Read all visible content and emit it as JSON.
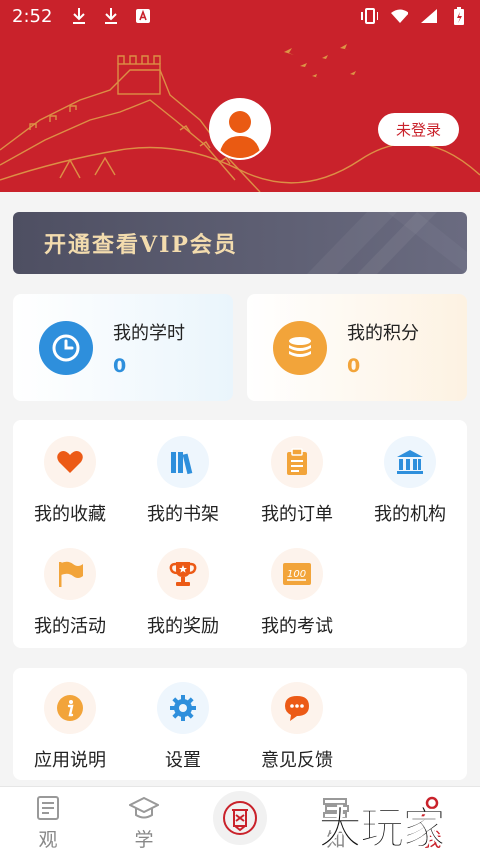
{
  "status_bar": {
    "time": "2:52"
  },
  "header": {
    "login_button": "未登录",
    "colors": {
      "background": "#c9222b",
      "deco": "#e0a24a"
    }
  },
  "vip": {
    "label": "开通查看VIP会员"
  },
  "stats": [
    {
      "label": "我的学时",
      "value": "0",
      "icon": "clock-icon",
      "color": "#2e8fdc"
    },
    {
      "label": "我的积分",
      "value": "0",
      "icon": "coins-icon",
      "color": "#f2a43a"
    }
  ],
  "menu": [
    {
      "label": "我的收藏",
      "icon": "heart-icon"
    },
    {
      "label": "我的书架",
      "icon": "bookshelf-icon"
    },
    {
      "label": "我的订单",
      "icon": "clipboard-icon"
    },
    {
      "label": "我的机构",
      "icon": "institution-icon"
    },
    {
      "label": "我的活动",
      "icon": "flag-icon"
    },
    {
      "label": "我的奖励",
      "icon": "trophy-icon"
    },
    {
      "label": "我的考试",
      "icon": "exam-icon"
    }
  ],
  "misc": [
    {
      "label": "应用说明",
      "icon": "info-icon"
    },
    {
      "label": "设置",
      "icon": "gear-icon"
    },
    {
      "label": "意见反馈",
      "icon": "chat-icon"
    }
  ],
  "bottom_nav": [
    {
      "label": "观",
      "icon": "document-icon"
    },
    {
      "label": "学",
      "icon": "graduation-cap-icon"
    },
    {
      "label": "",
      "icon": "seal-logo-icon"
    },
    {
      "label": "知",
      "icon": "books-icon"
    },
    {
      "label": "我",
      "icon": "person-icon"
    }
  ],
  "watermark": "大玩家"
}
